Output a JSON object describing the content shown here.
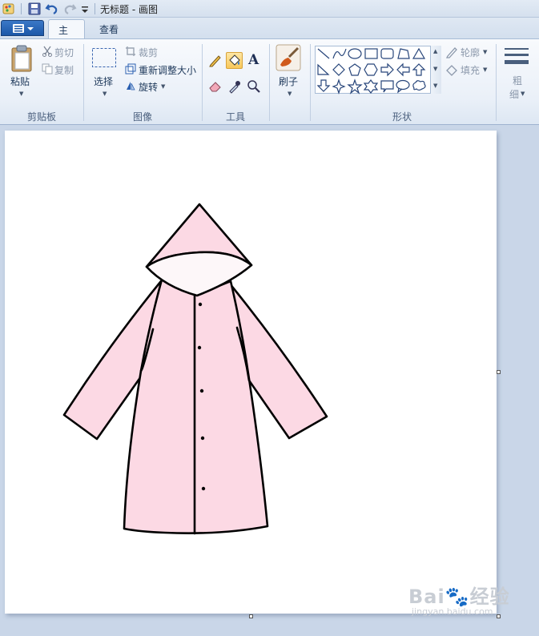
{
  "window": {
    "title": "无标题 - 画图"
  },
  "tabs": [
    {
      "label": "主页"
    },
    {
      "label": "查看"
    }
  ],
  "clipboard": {
    "paste": "粘贴",
    "cut": "剪切",
    "copy": "复制",
    "group": "剪贴板"
  },
  "image": {
    "select": "选择",
    "crop": "裁剪",
    "resize": "重新调整大小",
    "rotate": "旋转",
    "group": "图像"
  },
  "tools": {
    "group": "工具",
    "text_glyph": "A"
  },
  "brushes": {
    "label": "刷子"
  },
  "shapes": {
    "group": "形状",
    "outline": "轮廓",
    "fill": "填充"
  },
  "size": {
    "label_line1": "粗",
    "label_line2": "细"
  },
  "watermark": {
    "main": "Bai🐾经验",
    "sub": "jingyan.baidu.com"
  },
  "colors": {
    "raincoat_fill": "#fcd9e4",
    "hood_inner": "#fdf7f9",
    "outline": "#000000"
  }
}
